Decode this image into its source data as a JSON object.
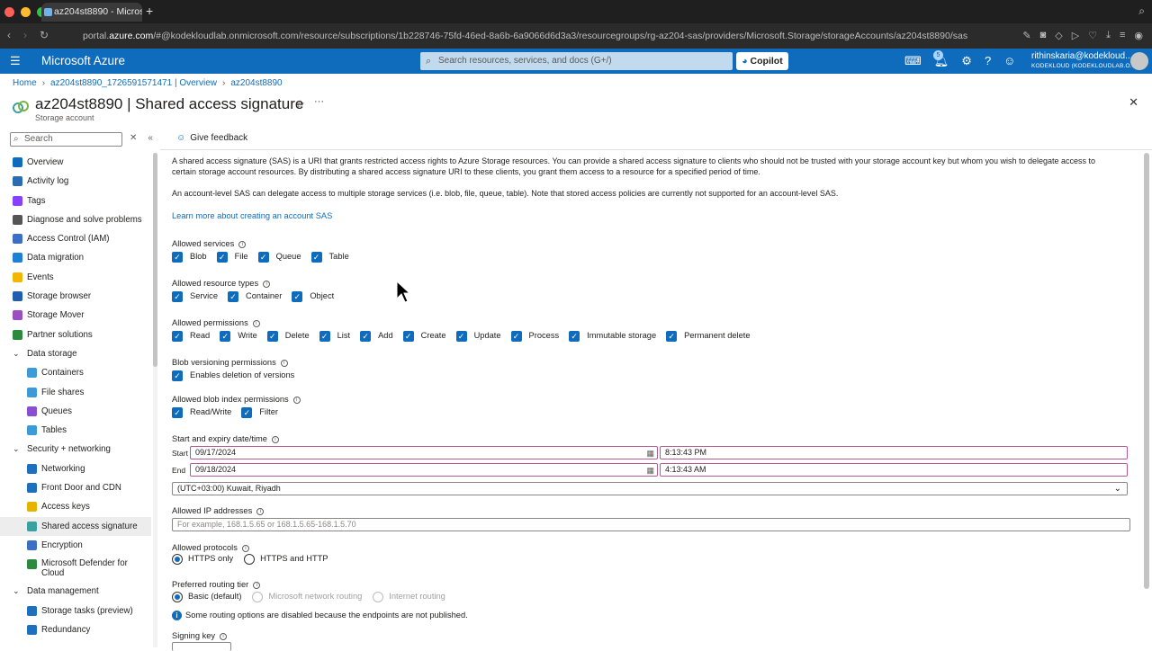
{
  "browser": {
    "tab_title": "az204st8890 - Microsof",
    "url_prefix": "portal.",
    "url_host": "azure.com",
    "url_rest": "/#@kodekloudlab.onmicrosoft.com/resource/subscriptions/1b228746-75fd-46ed-8a6b-6a9066d6d3a3/resourcegroups/rg-az204-sas/providers/Microsoft.Storage/storageAccounts/az204st8890/sas"
  },
  "header": {
    "brand": "Microsoft Azure",
    "search_placeholder": "Search resources, services, and docs (G+/)",
    "copilot": "Copilot",
    "notif_count": "5",
    "user_name": "rithinskaria@kodekloud...",
    "user_tenant": "KODEKLOUD (KODEKLOUDLAB.O..."
  },
  "breadcrumb": [
    "Home",
    "az204st8890_1726591571471 | Overview",
    "az204st8890"
  ],
  "page": {
    "title": "az204st8890 | Shared access signature",
    "subtitle": "Storage account"
  },
  "sidebar": {
    "search_placeholder": "Search",
    "items": [
      {
        "label": "Overview",
        "level": "l0",
        "color": "#0f6cbd"
      },
      {
        "label": "Activity log",
        "level": "l0",
        "color": "#2b6cb0"
      },
      {
        "label": "Tags",
        "level": "l0",
        "color": "#8a3ffc"
      },
      {
        "label": "Diagnose and solve problems",
        "level": "l0",
        "color": "#555"
      },
      {
        "label": "Access Control (IAM)",
        "level": "l0",
        "color": "#3a6fc4"
      },
      {
        "label": "Data migration",
        "level": "l0",
        "color": "#1d7fd6"
      },
      {
        "label": "Events",
        "level": "l0",
        "color": "#f2b600"
      },
      {
        "label": "Storage browser",
        "level": "l0",
        "color": "#1f5fad"
      },
      {
        "label": "Storage Mover",
        "level": "l0",
        "color": "#9c4fbf"
      },
      {
        "label": "Partner solutions",
        "level": "l0",
        "color": "#2b8a3e"
      },
      {
        "label": "Data storage",
        "level": "grp",
        "color": ""
      },
      {
        "label": "Containers",
        "level": "l1",
        "color": "#3c9ad7"
      },
      {
        "label": "File shares",
        "level": "l1",
        "color": "#3c9ad7"
      },
      {
        "label": "Queues",
        "level": "l1",
        "color": "#8a4fd1"
      },
      {
        "label": "Tables",
        "level": "l1",
        "color": "#3c9ad7"
      },
      {
        "label": "Security + networking",
        "level": "grp",
        "color": ""
      },
      {
        "label": "Networking",
        "level": "l1",
        "color": "#1f6fbf"
      },
      {
        "label": "Front Door and CDN",
        "level": "l1",
        "color": "#1f6fbf"
      },
      {
        "label": "Access keys",
        "level": "l1",
        "color": "#e6b400"
      },
      {
        "label": "Shared access signature",
        "level": "l1",
        "color": "#3aa0a0"
      },
      {
        "label": "Encryption",
        "level": "l1",
        "color": "#3c6fc4"
      },
      {
        "label": "Microsoft Defender for Cloud",
        "level": "l1",
        "color": "#2b8a3e"
      },
      {
        "label": "Data management",
        "level": "grp",
        "color": ""
      },
      {
        "label": "Storage tasks (preview)",
        "level": "l1",
        "color": "#1f6fbf"
      },
      {
        "label": "Redundancy",
        "level": "l1",
        "color": "#1f6fbf"
      }
    ]
  },
  "toolbar": {
    "feedback": "Give feedback"
  },
  "content": {
    "intro1": "A shared access signature (SAS) is a URI that grants restricted access rights to Azure Storage resources. You can provide a shared access signature to clients who should not be trusted with your storage account key but whom you wish to delegate access to certain storage account resources. By distributing a shared access signature URI to these clients, you grant them access to a resource for a specified period of time.",
    "intro2": "An account-level SAS can delegate access to multiple storage services (i.e. blob, file, queue, table). Note that stored access policies are currently not supported for an account-level SAS.",
    "learn_more": "Learn more about creating an account SAS",
    "allowed_services": {
      "label": "Allowed services",
      "items": [
        "Blob",
        "File",
        "Queue",
        "Table"
      ]
    },
    "allowed_resource_types": {
      "label": "Allowed resource types",
      "items": [
        "Service",
        "Container",
        "Object"
      ]
    },
    "allowed_permissions": {
      "label": "Allowed permissions",
      "items": [
        "Read",
        "Write",
        "Delete",
        "List",
        "Add",
        "Create",
        "Update",
        "Process",
        "Immutable storage",
        "Permanent delete"
      ]
    },
    "blob_versioning": {
      "label": "Blob versioning permissions",
      "items": [
        "Enables deletion of versions"
      ]
    },
    "blob_index": {
      "label": "Allowed blob index permissions",
      "items": [
        "Read/Write",
        "Filter"
      ]
    },
    "datetime": {
      "label": "Start and expiry date/time",
      "start_label": "Start",
      "start_date": "09/17/2024",
      "start_time": "8:13:43 PM",
      "end_label": "End",
      "end_date": "09/18/2024",
      "end_time": "4:13:43 AM",
      "timezone": "(UTC+03:00) Kuwait, Riyadh"
    },
    "ip": {
      "label": "Allowed IP addresses",
      "placeholder": "For example, 168.1.5.65 or 168.1.5.65-168.1.5.70"
    },
    "protocols": {
      "label": "Allowed protocols",
      "options": [
        "HTTPS only",
        "HTTPS and HTTP"
      ]
    },
    "routing": {
      "label": "Preferred routing tier",
      "options": [
        "Basic (default)",
        "Microsoft network routing",
        "Internet routing"
      ],
      "note": "Some routing options are disabled because the endpoints are not published."
    },
    "signing_key": {
      "label": "Signing key"
    }
  }
}
